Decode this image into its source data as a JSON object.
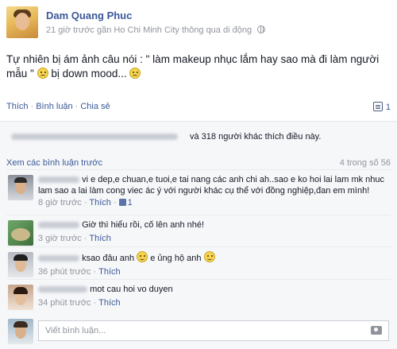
{
  "post": {
    "author": "Dam Quang Phuc",
    "time": "21 giờ trước",
    "location": "gần Ho Chi Minh City",
    "via": "thông qua di động",
    "text_part1": "Tự nhiên bị ám ảnh câu nói : \" làm makeup nhục lắm hay sao mà đi làm người mẫu \"",
    "text_part2": "bị down mood...",
    "icons": {
      "privacy": "globe-icon",
      "emoticon": "frown-emoticon"
    }
  },
  "actions": {
    "like": "Thích",
    "comment": "Bình luận",
    "share": "Chia sẻ",
    "separator": "·",
    "comment_count": "1"
  },
  "ufi": {
    "likes_text": "và 318 người khác thích điều này.",
    "view_previous": "Xem các bình luận trước",
    "count_label": "4 trong số 56",
    "input_placeholder": "Viết bình luận..."
  },
  "comments": [
    {
      "line1": "vi e dep,e chuan,e tuoi,e tai nang các anh chi ah..sao e ko hoi lai lam mk nhuc",
      "line2": "lam sao a lai làm cong viec ác ý với người khác cụ thể với đồng nghiệp,đan em mình!",
      "time": "8 giờ trước",
      "like": "Thích",
      "likes": "1"
    },
    {
      "line1": "Giờ thì hiểu rồi, cố lên anh nhé!",
      "time": "3 giờ trước",
      "like": "Thích"
    },
    {
      "line1a": "ksao đâu anh",
      "line1b": "e ủng hộ anh",
      "time": "36 phút trước",
      "like": "Thích"
    },
    {
      "line1": "mot cau hoi vo duyen",
      "time": "34 phút trước",
      "like": "Thích"
    }
  ],
  "colors": {
    "link": "#3b5998",
    "meta": "#90949c",
    "ufi_bg": "#f6f7f9"
  }
}
